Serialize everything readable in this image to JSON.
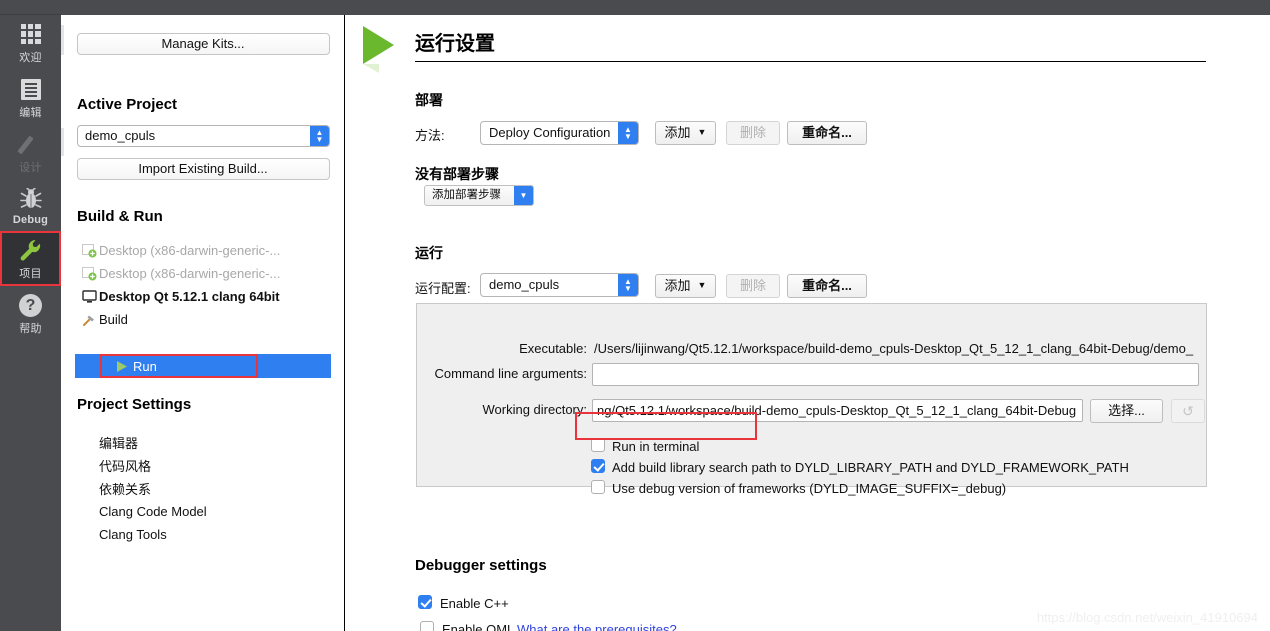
{
  "modebar": {
    "items": [
      {
        "label": "欢迎",
        "icon": "grid-icon",
        "state": "normal"
      },
      {
        "label": "编辑",
        "icon": "edit-icon",
        "state": "normal"
      },
      {
        "label": "设计",
        "icon": "pencil-icon",
        "state": "disabled"
      },
      {
        "label": "Debug",
        "icon": "bug-icon",
        "state": "normal"
      },
      {
        "label": "项目",
        "icon": "wrench-icon",
        "state": "selected"
      },
      {
        "label": "帮助",
        "icon": "question-icon",
        "state": "normal"
      }
    ]
  },
  "sidebar": {
    "manage_kits_label": "Manage Kits...",
    "active_project_title": "Active Project",
    "active_project_value": "demo_cpuls",
    "import_existing_build_label": "Import Existing Build...",
    "build_run_title": "Build & Run",
    "kits": [
      {
        "label": "Desktop (x86-darwin-generic-...",
        "icon": "kit-add-icon",
        "state": "disabled"
      },
      {
        "label": "Desktop (x86-darwin-generic-...",
        "icon": "kit-add-icon",
        "state": "disabled"
      },
      {
        "label": "Desktop Qt 5.12.1 clang 64bit",
        "icon": "monitor-icon",
        "state": "active"
      }
    ],
    "build_label": "Build",
    "run_label": "Run",
    "project_settings_title": "Project Settings",
    "project_settings": [
      {
        "label": "编辑器"
      },
      {
        "label": "代码风格"
      },
      {
        "label": "依赖关系"
      },
      {
        "label": "Clang Code Model"
      },
      {
        "label": "Clang Tools"
      }
    ]
  },
  "main": {
    "page_title": "运行设置",
    "deploy": {
      "heading": "部署",
      "method_label": "方法:",
      "method_value": "Deploy Configuration",
      "add_label": "添加",
      "remove_label": "删除",
      "rename_label": "重命名...",
      "no_steps_label": "没有部署步骤",
      "add_step_label": "添加部署步骤"
    },
    "run": {
      "heading": "运行",
      "config_label": "运行配置:",
      "config_value": "demo_cpuls",
      "add_label": "添加",
      "remove_label": "删除",
      "rename_label": "重命名...",
      "executable_label": "Executable:",
      "executable_value": "/Users/lijinwang/Qt5.12.1/workspace/build-demo_cpuls-Desktop_Qt_5_12_1_clang_64bit-Debug/demo_",
      "cmdargs_label": "Command line arguments:",
      "cmdargs_value": "",
      "cmdargs_placeholder": "",
      "workdir_label": "Working directory:",
      "workdir_value": "ng/Qt5.12.1/workspace/build-demo_cpuls-Desktop_Qt_5_12_1_clang_64bit-Debug",
      "browse_label": "选择...",
      "reset_icon": "revert-icon",
      "checkboxes": [
        {
          "label": "Run in terminal",
          "checked": false,
          "highlighted": true
        },
        {
          "label": "Add build library search path to DYLD_LIBRARY_PATH and DYLD_FRAMEWORK_PATH",
          "checked": true,
          "highlighted": false
        },
        {
          "label": "Use debug version of frameworks (DYLD_IMAGE_SUFFIX=_debug)",
          "checked": false,
          "highlighted": false
        }
      ]
    },
    "debugger": {
      "heading": "Debugger settings",
      "enable_cpp_label": "Enable C++",
      "enable_cpp_checked": true,
      "enable_qml_label": "Enable QML",
      "enable_qml_checked": false,
      "prerequisites_link": "What are the prerequisites?"
    }
  },
  "watermark": "https://blog.csdn.net/weixin_41910694",
  "colors": {
    "accent_blue": "#2f7ff0",
    "highlight_red": "#e8343a",
    "sidebar_dark": "#4a4b4f",
    "run_green": "#6ab82e",
    "link_blue": "#2f43e0"
  }
}
